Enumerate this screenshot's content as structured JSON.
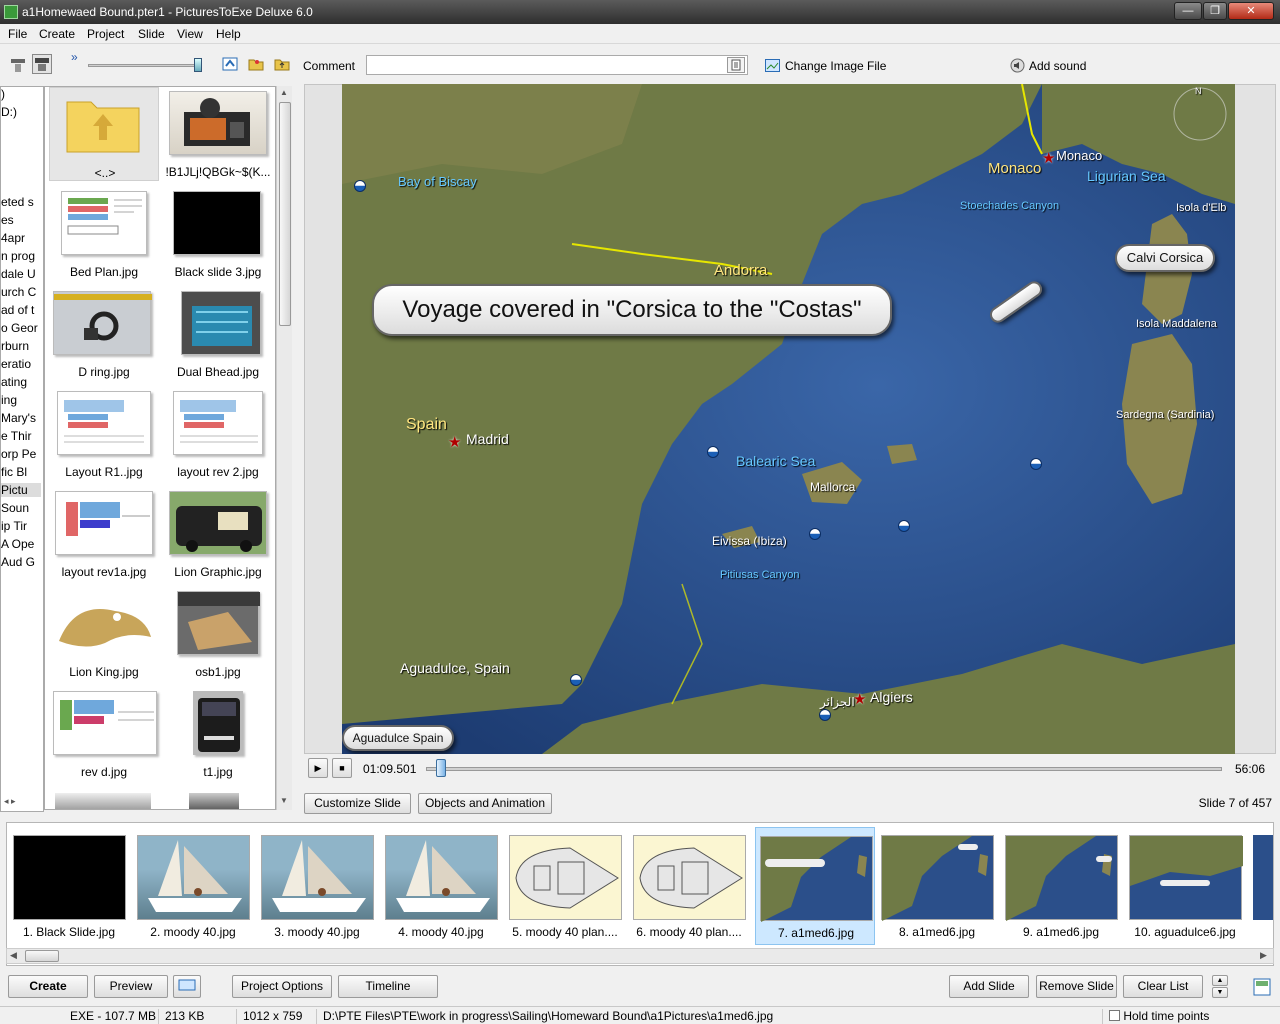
{
  "window": {
    "title": "a1Homewaed Bound.pter1 - PicturesToExe Deluxe 6.0",
    "minimize": "—",
    "restore": "❐",
    "close": "✕"
  },
  "menu": [
    "File",
    "Create",
    "Project",
    "Slide",
    "View",
    "Help"
  ],
  "top_toolbar": {
    "comment_label": "Comment",
    "comment_value": "",
    "change_image_label": "Change Image File",
    "add_sound_label": "Add sound",
    "more_glyph": "»"
  },
  "folder_tree": {
    "rows": [
      ")",
      "D:)",
      "eted s",
      "es",
      "4apr",
      "n prog",
      "dale U",
      "urch C",
      "ad of t",
      "o Geor",
      "rburn",
      "eratio",
      "ating",
      "ing",
      "Mary's",
      "e Thir",
      "orp Pe",
      "fic Bl",
      "Pictu",
      "Soun",
      "ip Tir",
      "A Ope",
      "Aud G"
    ],
    "selected_row": "Pictu"
  },
  "file_browser": {
    "items": [
      {
        "name": "<..>",
        "type": "folder"
      },
      {
        "name": "!B1JLj!QBGk~$(K...",
        "type": "image"
      },
      {
        "name": "Bed Plan.jpg",
        "type": "image"
      },
      {
        "name": "Black slide 3.jpg",
        "type": "image"
      },
      {
        "name": "D ring.jpg",
        "type": "image"
      },
      {
        "name": "Dual Bhead.jpg",
        "type": "image"
      },
      {
        "name": "Layout R1..jpg",
        "type": "image"
      },
      {
        "name": "layout rev 2.jpg",
        "type": "image"
      },
      {
        "name": "layout rev1a.jpg",
        "type": "image"
      },
      {
        "name": "Lion Graphic.jpg",
        "type": "image"
      },
      {
        "name": "Lion King.jpg",
        "type": "image"
      },
      {
        "name": "osb1.jpg",
        "type": "image"
      },
      {
        "name": "rev d.jpg",
        "type": "image"
      },
      {
        "name": "t1.jpg",
        "type": "image"
      }
    ]
  },
  "preview": {
    "captions": {
      "voyage": "Voyage covered in \"Corsica to the \"Costas\"",
      "calvi": "Calvi Corsica",
      "aguadulce": "Aguadulce Spain"
    },
    "map_labels": {
      "bay_of_biscay": "Bay of Biscay",
      "monaco_city": "Monaco",
      "monaco_region": "Monaco",
      "ligurian_sea": "Ligurian Sea",
      "stoechades": "Stoechades Canyon",
      "isola_elba": "Isola d'Elb",
      "andorra": "Andorra",
      "isola_maddalena": "Isola Maddalena",
      "sardegna": "Sardegna (Sardinia)",
      "spain": "Spain",
      "madrid": "Madrid",
      "balearic_sea": "Balearic Sea",
      "mallorca": "Mallorca",
      "eivissa": "Eivissa (Ibiza)",
      "pitiusas": "Pitiusas Canyon",
      "aguadulce_map": "Aguadulce, Spain",
      "algiers": "Algiers",
      "algiers_ar": "الجزائر",
      "compass_n": "N"
    }
  },
  "player": {
    "time_current": "01:09.501",
    "time_total": "56:06",
    "position_fraction": 0.002,
    "play_glyph": "▶",
    "stop_glyph": "■"
  },
  "slide_buttons": {
    "customize": "Customize Slide",
    "objects": "Objects and Animation",
    "slide_counter": "Slide 7 of 457"
  },
  "slides": [
    {
      "label": "1. Black Slide.jpg",
      "kind": "black"
    },
    {
      "label": "2. moody 40.jpg",
      "kind": "boat"
    },
    {
      "label": "3. moody 40.jpg",
      "kind": "boat"
    },
    {
      "label": "4. moody 40.jpg",
      "kind": "boat"
    },
    {
      "label": "5. moody 40 plan....",
      "kind": "plan"
    },
    {
      "label": "6. moody 40 plan....",
      "kind": "plan"
    },
    {
      "label": "7. a1med6.jpg",
      "kind": "map",
      "selected": true
    },
    {
      "label": "8. a1med6.jpg",
      "kind": "map"
    },
    {
      "label": "9. a1med6.jpg",
      "kind": "map"
    },
    {
      "label": "10. aguadulce6.jpg",
      "kind": "map"
    }
  ],
  "bottom_buttons": {
    "create": "Create",
    "preview": "Preview",
    "project_options": "Project Options",
    "timeline": "Timeline",
    "add_slide": "Add Slide",
    "remove_slide": "Remove Slide",
    "clear_list": "Clear List"
  },
  "status": {
    "exe_size": "EXE - 107.7 MB",
    "file_size": "213 KB",
    "dimensions": "1012 x 759",
    "path": "D:\\PTE Files\\PTE\\work in progress\\Sailing\\Homeward Bound\\a1Pictures\\a1med6.jpg",
    "hold_label": "Hold time points",
    "hold_checked": false
  },
  "colors": {
    "title_bg": "#3a3a3a",
    "sea": "#2b4f8a",
    "land": "#6f7a46",
    "border_yellow": "#e6e600",
    "selected_slide": "#cde8ff"
  }
}
